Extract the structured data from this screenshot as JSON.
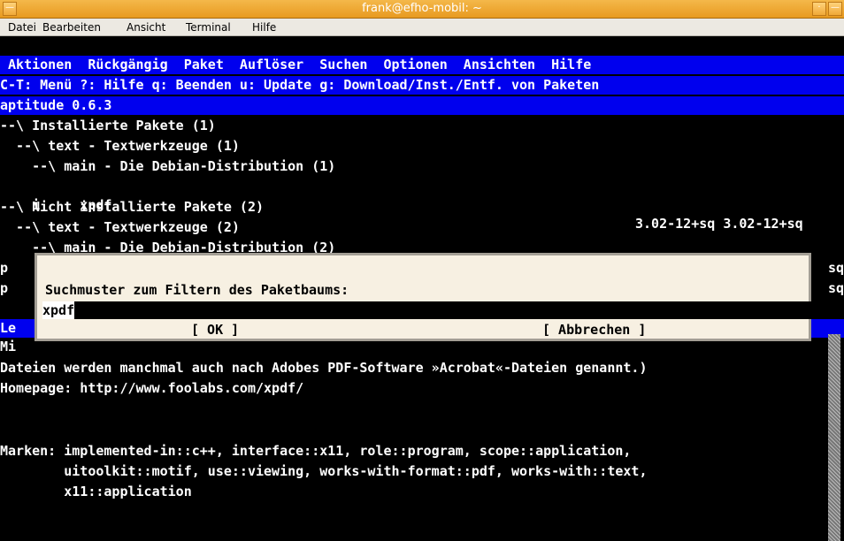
{
  "window": {
    "title": "frank@efho-mobil: ~",
    "controls": {
      "left": "—",
      "min": "·",
      "close": "—"
    }
  },
  "menubar": [
    "Datei",
    "Bearbeiten",
    "Ansicht",
    "Terminal",
    "Hilfe"
  ],
  "aptitude": {
    "menus": " Aktionen  Rückgängig  Paket  Auflöser  Suchen  Optionen  Ansichten  Hilfe",
    "help": "C-T: Menü ?: Hilfe q: Beenden u: Update g: Download/Inst./Entf. von Paketen",
    "version": "aptitude 0.6.3"
  },
  "tree": {
    "installed": "--\\ Installierte Pakete (1)",
    "text_installed": "  --\\ text - Textwerkzeuge (1)",
    "main_installed": "    --\\ main - Die Debian-Distribution (1)",
    "pkg_row_state": "i",
    "pkg_row_name": "     xpdf",
    "pkg_row_versions": "3.02-12+sq 3.02-12+sq",
    "not_installed": "--\\ Nicht installierte Pakete (2)",
    "text_not_installed": "  --\\ text - Textwerkzeuge (2)",
    "main_not_installed": "    --\\ main - Die Debian-Distribution (2)",
    "hidden_row1_left": "p",
    "hidden_row1_right": "sq",
    "hidden_row2_left": "p",
    "hidden_row2_right": "sq"
  },
  "partial": {
    "le": "Le",
    "mi": "Mi"
  },
  "description": {
    "line1": "Dateien werden manchmal auch nach Adobes PDF-Software »Acrobat«-Dateien genannt.)",
    "homepage_label": "Homepage:",
    "homepage_url": " http://www.foolabs.com/xpdf/",
    "tags_label": "Marken:",
    "tags_line1": " implemented-in::c++, interface::x11, role::program, scope::application,",
    "tags_line2": "        uitoolkit::motif, use::viewing, works-with-format::pdf, works-with::text,",
    "tags_line3": "        x11::application"
  },
  "dialog": {
    "prompt": "Suchmuster zum Filtern des Paketbaums:",
    "input_value": "xpdf",
    "ok_label": "[ OK ]",
    "cancel_label": "[ Abbrechen ]"
  }
}
